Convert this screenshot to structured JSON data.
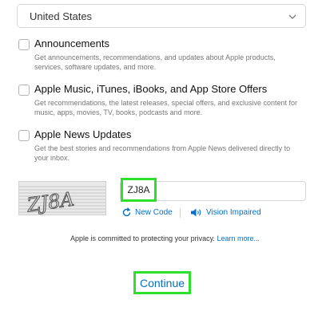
{
  "country_select": {
    "value": "United States"
  },
  "options": [
    {
      "title": "Announcements",
      "desc": "Get announcements, recommendations, and updates about Apple products, services, software updates, and more."
    },
    {
      "title": "Apple Music, iTunes, iBooks, and App Store Offers",
      "desc": "Get recommendations, the latest releases, special offers, and exclusive content for music, apps, movies, TV, books, podcasts and more."
    },
    {
      "title": "Apple News Updates",
      "desc": "Get the best stories and recommendations from Apple News delivered directly to your inbox."
    }
  ],
  "captcha": {
    "image_text": "ZJ8A",
    "input_value": "ZJ8A",
    "new_code_label": "New Code",
    "vision_impaired_label": "Vision Impaired"
  },
  "privacy": {
    "text": "Apple is committed to protecting your privacy.",
    "link": "Learn more..."
  },
  "continue_label": "Continue",
  "colors": {
    "link": "#0070c9",
    "highlight": "#2ee02e"
  }
}
